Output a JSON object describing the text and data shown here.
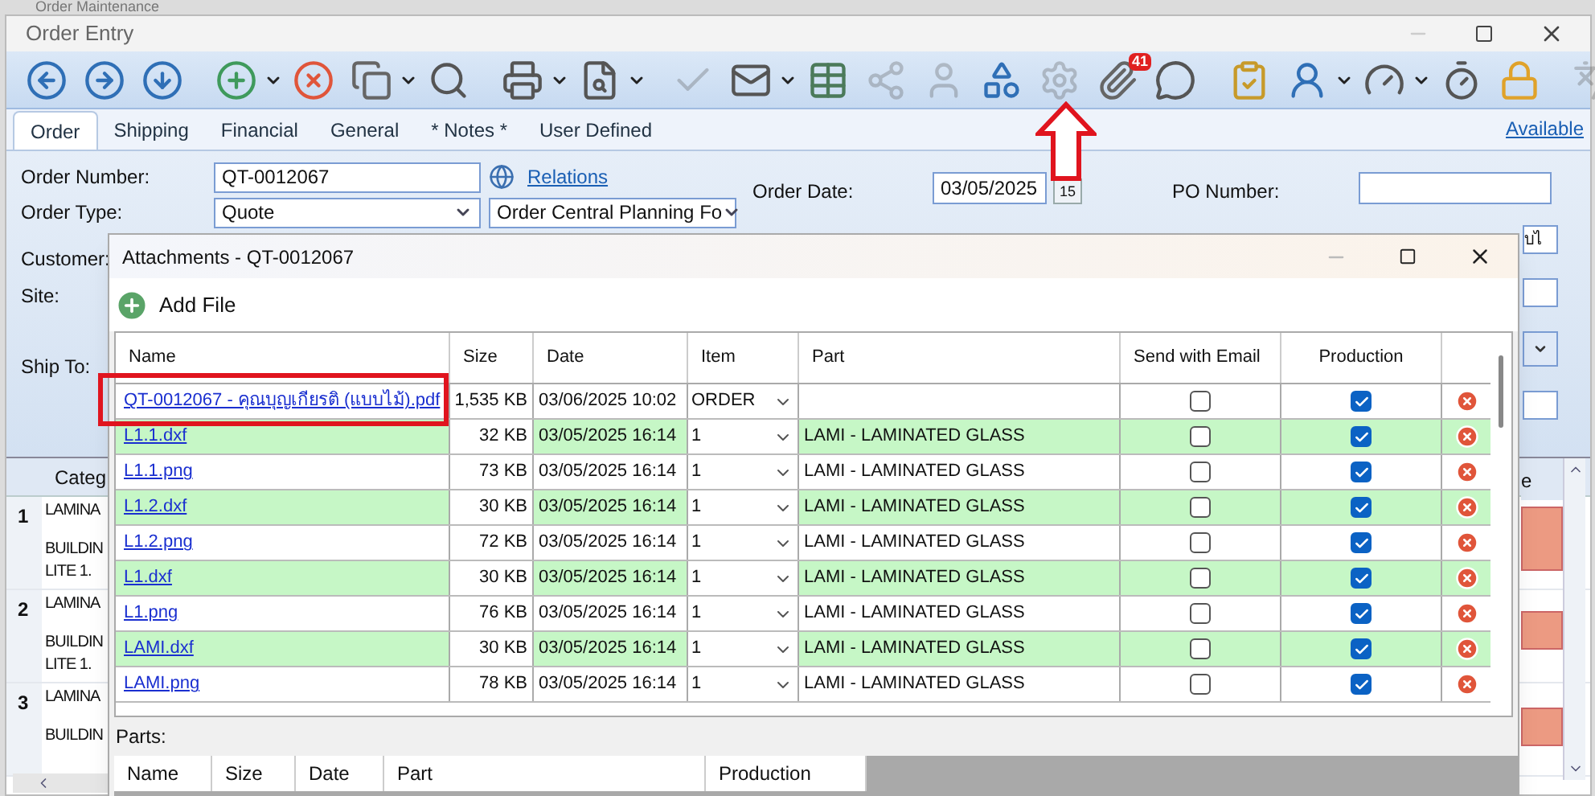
{
  "app_title": "Order Maintenance",
  "window": {
    "title": "Order Entry"
  },
  "toolbar": [
    {
      "kind": "back",
      "disabled": false,
      "dropdown": false
    },
    {
      "kind": "forward",
      "disabled": false,
      "dropdown": false
    },
    {
      "kind": "down",
      "disabled": false,
      "dropdown": false
    },
    {
      "kind": "sep"
    },
    {
      "kind": "add",
      "disabled": false,
      "dropdown": true
    },
    {
      "kind": "delete",
      "disabled": false,
      "dropdown": false
    },
    {
      "kind": "copy",
      "disabled": false,
      "dropdown": true
    },
    {
      "kind": "search",
      "disabled": false,
      "dropdown": false
    },
    {
      "kind": "sep"
    },
    {
      "kind": "print",
      "disabled": false,
      "dropdown": true
    },
    {
      "kind": "preview",
      "disabled": false,
      "dropdown": true
    },
    {
      "kind": "sep"
    },
    {
      "kind": "check",
      "disabled": true,
      "dropdown": false
    },
    {
      "kind": "mail",
      "disabled": false,
      "dropdown": true
    },
    {
      "kind": "list",
      "disabled": false,
      "dropdown": false
    },
    {
      "kind": "share",
      "disabled": true,
      "dropdown": false
    },
    {
      "kind": "user",
      "disabled": true,
      "dropdown": false
    },
    {
      "kind": "shapes",
      "disabled": false,
      "dropdown": false
    },
    {
      "kind": "gear",
      "disabled": true,
      "dropdown": false
    },
    {
      "kind": "attach",
      "disabled": false,
      "dropdown": false,
      "badge": "41"
    },
    {
      "kind": "chat",
      "disabled": false,
      "dropdown": false
    },
    {
      "kind": "sep"
    },
    {
      "kind": "clipboard",
      "disabled": false,
      "dropdown": false
    },
    {
      "kind": "person",
      "disabled": false,
      "dropdown": true
    },
    {
      "kind": "meters",
      "disabled": false,
      "dropdown": true
    },
    {
      "kind": "clock",
      "disabled": false,
      "dropdown": false
    },
    {
      "kind": "lock",
      "disabled": false,
      "dropdown": false
    },
    {
      "kind": "grip"
    },
    {
      "kind": "translate",
      "disabled": true,
      "dropdown": false
    }
  ],
  "tabs": [
    {
      "label": "Order",
      "selected": true
    },
    {
      "label": "Shipping",
      "selected": false
    },
    {
      "label": "Financial",
      "selected": false
    },
    {
      "label": "General",
      "selected": false
    },
    {
      "label": "* Notes *",
      "selected": false
    },
    {
      "label": "User Defined",
      "selected": false
    }
  ],
  "available_link": "Available",
  "form": {
    "order_number_label": "Order Number:",
    "order_number": "QT-0012067",
    "relations_link": "Relations",
    "order_type_label": "Order Type:",
    "order_type": "Quote",
    "planning_form": "Order Central Planning Fo",
    "order_date_label": "Order Date:",
    "order_date": "03/05/2025",
    "calendar_button": "15",
    "po_number_label": "PO Number:",
    "customer_label": "Customer:",
    "site_label": "Site:",
    "ship_to_label": "Ship To:",
    "side_field": "บไ"
  },
  "lines_grid": {
    "category_header": "Categ",
    "right_header": "e",
    "rows": [
      {
        "number": "1",
        "lines": [
          "LAMINA",
          "BUILDIN",
          "LITE 1."
        ]
      },
      {
        "number": "2",
        "lines": [
          "LAMINA",
          "BUILDIN",
          "LITE 1."
        ]
      },
      {
        "number": "3",
        "lines": [
          "LAMINA",
          "BUILDIN"
        ]
      }
    ]
  },
  "dialog": {
    "title": "Attachments - QT-0012067",
    "add_file": "Add File",
    "columns": [
      "Name",
      "Size",
      "Date",
      "Item",
      "Part",
      "Send with Email",
      "Production"
    ],
    "rows": [
      {
        "name": "QT-0012067 - คุณบุญเกียรติ (แบบไม้).pdf",
        "size": "1,535 KB",
        "date": "03/06/2025 10:02",
        "item": "ORDER",
        "part": "",
        "send_email": false,
        "production": true
      },
      {
        "name": "L1.1.dxf",
        "size": "32 KB",
        "date": "03/05/2025 16:14",
        "item": "1",
        "part": "LAMI - LAMINATED GLASS",
        "send_email": false,
        "production": true
      },
      {
        "name": "L1.1.png",
        "size": "73 KB",
        "date": "03/05/2025 16:14",
        "item": "1",
        "part": "LAMI - LAMINATED GLASS",
        "send_email": false,
        "production": true
      },
      {
        "name": "L1.2.dxf",
        "size": "30 KB",
        "date": "03/05/2025 16:14",
        "item": "1",
        "part": "LAMI - LAMINATED GLASS",
        "send_email": false,
        "production": true
      },
      {
        "name": "L1.2.png",
        "size": "72 KB",
        "date": "03/05/2025 16:14",
        "item": "1",
        "part": "LAMI - LAMINATED GLASS",
        "send_email": false,
        "production": true
      },
      {
        "name": "L1.dxf",
        "size": "30 KB",
        "date": "03/05/2025 16:14",
        "item": "1",
        "part": "LAMI - LAMINATED GLASS",
        "send_email": false,
        "production": true
      },
      {
        "name": "L1.png",
        "size": "76 KB",
        "date": "03/05/2025 16:14",
        "item": "1",
        "part": "LAMI - LAMINATED GLASS",
        "send_email": false,
        "production": true
      },
      {
        "name": "LAMI.dxf",
        "size": "30 KB",
        "date": "03/05/2025 16:14",
        "item": "1",
        "part": "LAMI - LAMINATED GLASS",
        "send_email": false,
        "production": true
      },
      {
        "name": "LAMI.png",
        "size": "78 KB",
        "date": "03/05/2025 16:14",
        "item": "1",
        "part": "LAMI - LAMINATED GLASS",
        "send_email": false,
        "production": true
      }
    ],
    "parts_label": "Parts:",
    "parts_columns": [
      "Name",
      "Size",
      "Date",
      "Part",
      "Production"
    ]
  },
  "callouts": {
    "highlight_box": true,
    "arrow": true
  }
}
